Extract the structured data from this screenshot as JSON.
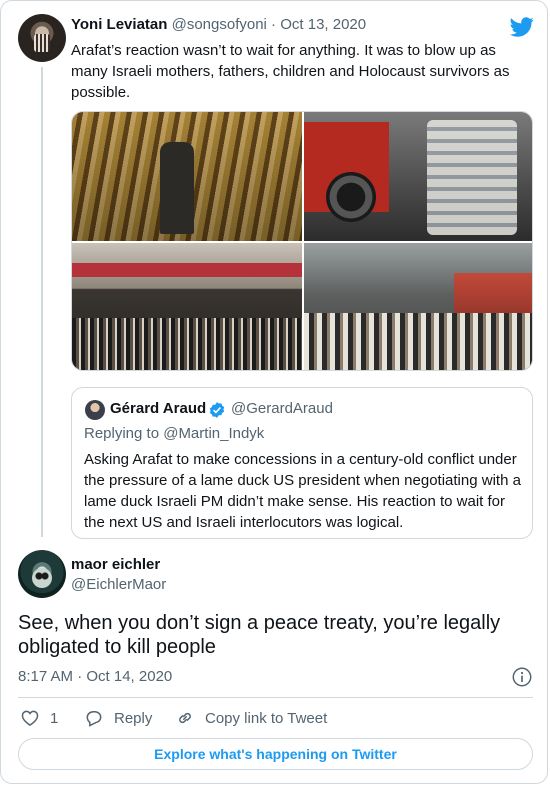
{
  "colors": {
    "brand_blue": "#1d9bf0",
    "text": "#0f1419",
    "secondary": "#536471",
    "border": "#cfd9de"
  },
  "parent_tweet": {
    "name": "Yoni Leviatan",
    "handle": "@songsofyoni",
    "separator": "·",
    "date": "Oct 13, 2020",
    "text": "Arafat’s reaction wasn’t to wait for anything. It was to blow up as many Israeli mothers, fathers, children and Holocaust survivors as possible.",
    "media_count": 4
  },
  "quoted_tweet": {
    "name": "Gérard Araud",
    "handle": "@GerardAraud",
    "verified": true,
    "replying_to": "Replying to @Martin_Indyk",
    "text": "Asking Arafat to make concessions in a century-old conflict under the pressure of a lame duck US president when negotiating with a lame duck Israeli PM didn’t make sense. His reaction to wait for the next US and Israeli interlocutors was logical."
  },
  "reply_tweet": {
    "name": "maor eichler",
    "handle": "@EichlerMaor",
    "text": "See, when you don’t sign a peace treaty, you’re legally obligated to kill people",
    "time": "8:17 AM · Oct 14, 2020"
  },
  "actions": {
    "like_count": "1",
    "reply_label": "Reply",
    "copy_label": "Copy link to Tweet"
  },
  "explore_label": "Explore what's happening on Twitter",
  "icons": [
    "twitter-bird-icon",
    "verified-badge-icon",
    "info-icon",
    "heart-icon",
    "reply-bubble-icon",
    "link-icon"
  ]
}
